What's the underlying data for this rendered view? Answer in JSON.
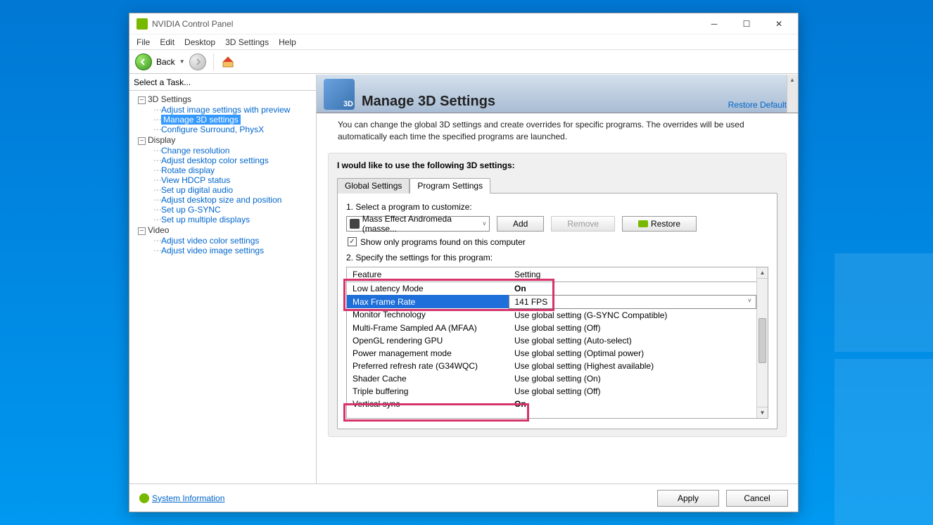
{
  "title": "NVIDIA Control Panel",
  "menu": [
    "File",
    "Edit",
    "Desktop",
    "3D Settings",
    "Help"
  ],
  "toolbar": {
    "back": "Back"
  },
  "sidebar": {
    "header": "Select a Task...",
    "cat1": "3D Settings",
    "cat1_items": [
      "Adjust image settings with preview",
      "Manage 3D settings",
      "Configure Surround, PhysX"
    ],
    "cat2": "Display",
    "cat2_items": [
      "Change resolution",
      "Adjust desktop color settings",
      "Rotate display",
      "View HDCP status",
      "Set up digital audio",
      "Adjust desktop size and position",
      "Set up G-SYNC",
      "Set up multiple displays"
    ],
    "cat3": "Video",
    "cat3_items": [
      "Adjust video color settings",
      "Adjust video image settings"
    ]
  },
  "main": {
    "heading": "Manage 3D Settings",
    "restore": "Restore Defaults",
    "desc": "You can change the global 3D settings and create overrides for specific programs. The overrides will be used automatically each time the specified programs are launched.",
    "panel_title": "I would like to use the following 3D settings:",
    "tabs": [
      "Global Settings",
      "Program Settings"
    ],
    "step1": "1. Select a program to customize:",
    "program": "Mass Effect Andromeda (masse...",
    "add": "Add",
    "remove": "Remove",
    "restorebtn": "Restore",
    "show_only": "Show only programs found on this computer",
    "step2": "2. Specify the settings for this program:",
    "col_feature": "Feature",
    "col_setting": "Setting",
    "rows": [
      {
        "f": "Low Latency Mode",
        "s": "On",
        "bold": true
      },
      {
        "f": "Max Frame Rate",
        "s": "141 FPS",
        "sel": true
      },
      {
        "f": "Monitor Technology",
        "s": "Use global setting (G-SYNC Compatible)"
      },
      {
        "f": "Multi-Frame Sampled AA (MFAA)",
        "s": "Use global setting (Off)"
      },
      {
        "f": "OpenGL rendering GPU",
        "s": "Use global setting (Auto-select)"
      },
      {
        "f": "Power management mode",
        "s": "Use global setting (Optimal power)"
      },
      {
        "f": "Preferred refresh rate (G34WQC)",
        "s": "Use global setting (Highest available)"
      },
      {
        "f": "Shader Cache",
        "s": "Use global setting (On)"
      },
      {
        "f": "Triple buffering",
        "s": "Use global setting (Off)"
      },
      {
        "f": "Vertical sync",
        "s": "On",
        "bold": true
      }
    ]
  },
  "footer": {
    "sysinfo": "System Information",
    "apply": "Apply",
    "cancel": "Cancel"
  }
}
